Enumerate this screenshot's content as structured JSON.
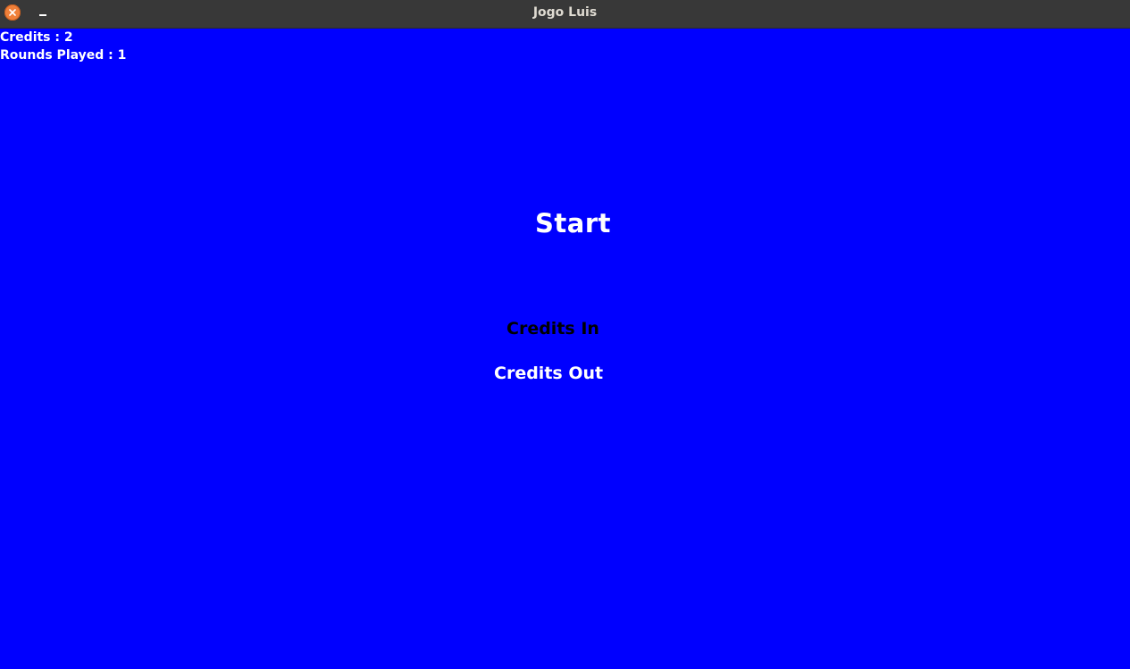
{
  "window": {
    "title": "Jogo Luis",
    "close_icon": "close-icon",
    "minimize_icon": "minimize-icon"
  },
  "stats": {
    "credits": "Credits : 2",
    "rounds": "Rounds Played : 1"
  },
  "menu": {
    "start": "Start",
    "credits_in": "Credits In",
    "credits_out": "Credits Out",
    "selected": "Credits In"
  },
  "colors": {
    "background": "#0000ff",
    "titlebar": "#383838",
    "text": "#ffffff",
    "selected_text": "#000000",
    "close_button": "#f0803a"
  }
}
